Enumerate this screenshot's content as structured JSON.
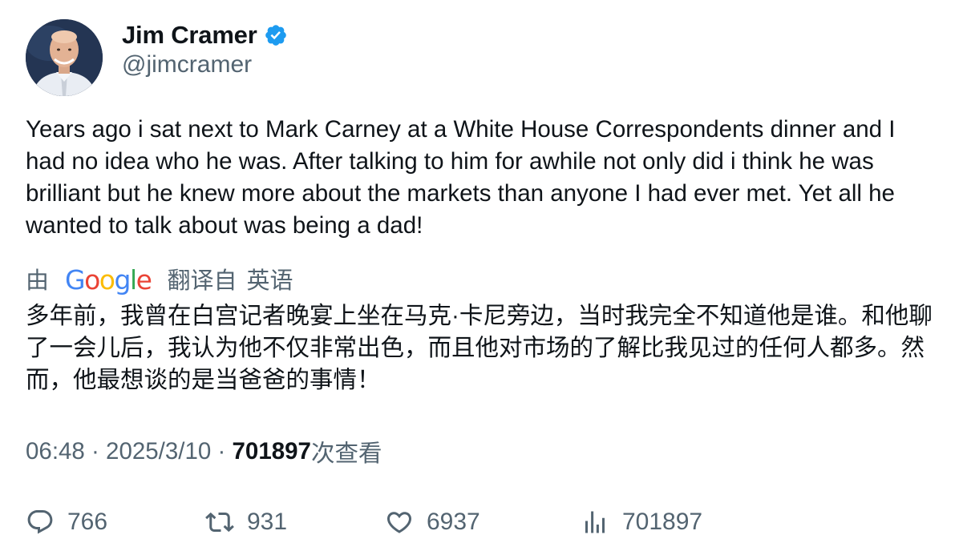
{
  "author": {
    "display_name": "Jim Cramer",
    "handle": "@jimcramer",
    "verified": true,
    "verified_color": "#1d9bf0"
  },
  "tweet": {
    "text": "Years ago i sat next to Mark Carney at a White House Correspondents dinner and I had no idea who he was. After talking to him for awhile not only did i think he was brilliant but he knew more about the markets than anyone I had ever met. Yet all he wanted to talk about was being a dad!"
  },
  "translation": {
    "by_label": "由",
    "provider": "Google",
    "from_label": "翻译自",
    "language": "英语",
    "text": "多年前，我曾在白宫记者晚宴上坐在马克·卡尼旁边，当时我完全不知道他是谁。和他聊了一会儿后，我认为他不仅非常出色，而且他对市场的了解比我见过的任何人都多。然而，他最想谈的是当爸爸的事情！"
  },
  "meta": {
    "time": "06:48",
    "separator": " · ",
    "date": "2025/3/10",
    "views": "701897",
    "views_suffix": "次查看"
  },
  "actions": {
    "replies": "766",
    "retweets": "931",
    "likes": "6937",
    "views": "701897"
  },
  "icons": {
    "reply": "reply-icon",
    "retweet": "retweet-icon",
    "like": "heart-icon",
    "views": "views-chart-icon",
    "verified": "verified-badge-icon"
  },
  "colors": {
    "text": "#0f1419",
    "secondary": "#536471",
    "google_blue": "#4285F4",
    "google_red": "#EA4335",
    "google_yellow": "#FBBC05",
    "google_green": "#34A853"
  }
}
